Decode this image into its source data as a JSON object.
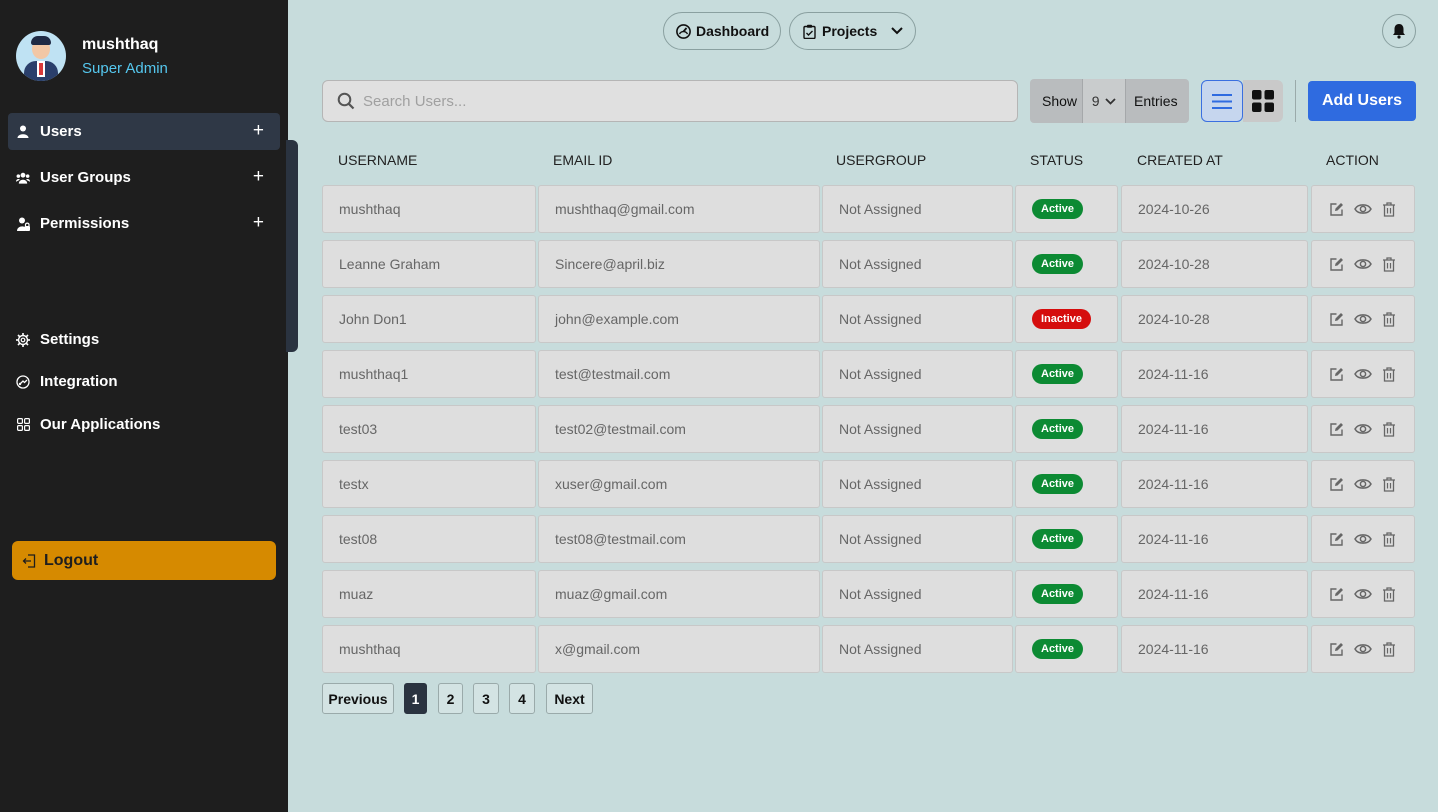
{
  "user": {
    "name": "mushthaq",
    "role": "Super Admin"
  },
  "sidebar": {
    "items": [
      {
        "label": "Users",
        "icon": "user-icon",
        "expandable": true,
        "active": true
      },
      {
        "label": "User Groups",
        "icon": "users-icon",
        "expandable": true
      },
      {
        "label": "Permissions",
        "icon": "user-lock-icon",
        "expandable": true
      },
      {
        "label": "Settings",
        "icon": "gear-icon"
      },
      {
        "label": "Integration",
        "icon": "integration-icon"
      },
      {
        "label": "Our Applications",
        "icon": "apps-grid-icon"
      }
    ],
    "logout_label": "Logout"
  },
  "topbar": {
    "dashboard_label": "Dashboard",
    "projects_label": "Projects"
  },
  "toolbar": {
    "search_placeholder": "Search Users...",
    "show_label": "Show",
    "entries_value": "9",
    "entries_label": "Entries",
    "add_label": "Add Users"
  },
  "table": {
    "columns": [
      "USERNAME",
      "EMAIL ID",
      "USERGROUP",
      "STATUS",
      "CREATED AT",
      "ACTION"
    ],
    "rows": [
      {
        "username": "mushthaq",
        "email": "mushthaq@gmail.com",
        "group": "Not Assigned",
        "status": "Active",
        "created": "2024-10-26"
      },
      {
        "username": "Leanne Graham",
        "email": "Sincere@april.biz",
        "group": "Not Assigned",
        "status": "Active",
        "created": "2024-10-28"
      },
      {
        "username": "John Don1",
        "email": "john@example.com",
        "group": "Not Assigned",
        "status": "Inactive",
        "created": "2024-10-28"
      },
      {
        "username": "mushthaq1",
        "email": "test@testmail.com",
        "group": "Not Assigned",
        "status": "Active",
        "created": "2024-11-16"
      },
      {
        "username": "test03",
        "email": "test02@testmail.com",
        "group": "Not Assigned",
        "status": "Active",
        "created": "2024-11-16"
      },
      {
        "username": "testx",
        "email": "xuser@gmail.com",
        "group": "Not Assigned",
        "status": "Active",
        "created": "2024-11-16"
      },
      {
        "username": "test08",
        "email": "test08@testmail.com",
        "group": "Not Assigned",
        "status": "Active",
        "created": "2024-11-16"
      },
      {
        "username": "muaz",
        "email": "muaz@gmail.com",
        "group": "Not Assigned",
        "status": "Active",
        "created": "2024-11-16"
      },
      {
        "username": "mushthaq",
        "email": "x@gmail.com",
        "group": "Not Assigned",
        "status": "Active",
        "created": "2024-11-16"
      }
    ]
  },
  "pagination": {
    "previous": "Previous",
    "pages": [
      "1",
      "2",
      "3",
      "4"
    ],
    "current": "1",
    "next": "Next"
  },
  "colors": {
    "accent": "#2f6be0",
    "sidebar_bg": "#1e1e1e",
    "logout": "#d68a00",
    "active": "#0c8a33",
    "inactive": "#d50d0d",
    "main_bg": "#c7dcdc"
  }
}
